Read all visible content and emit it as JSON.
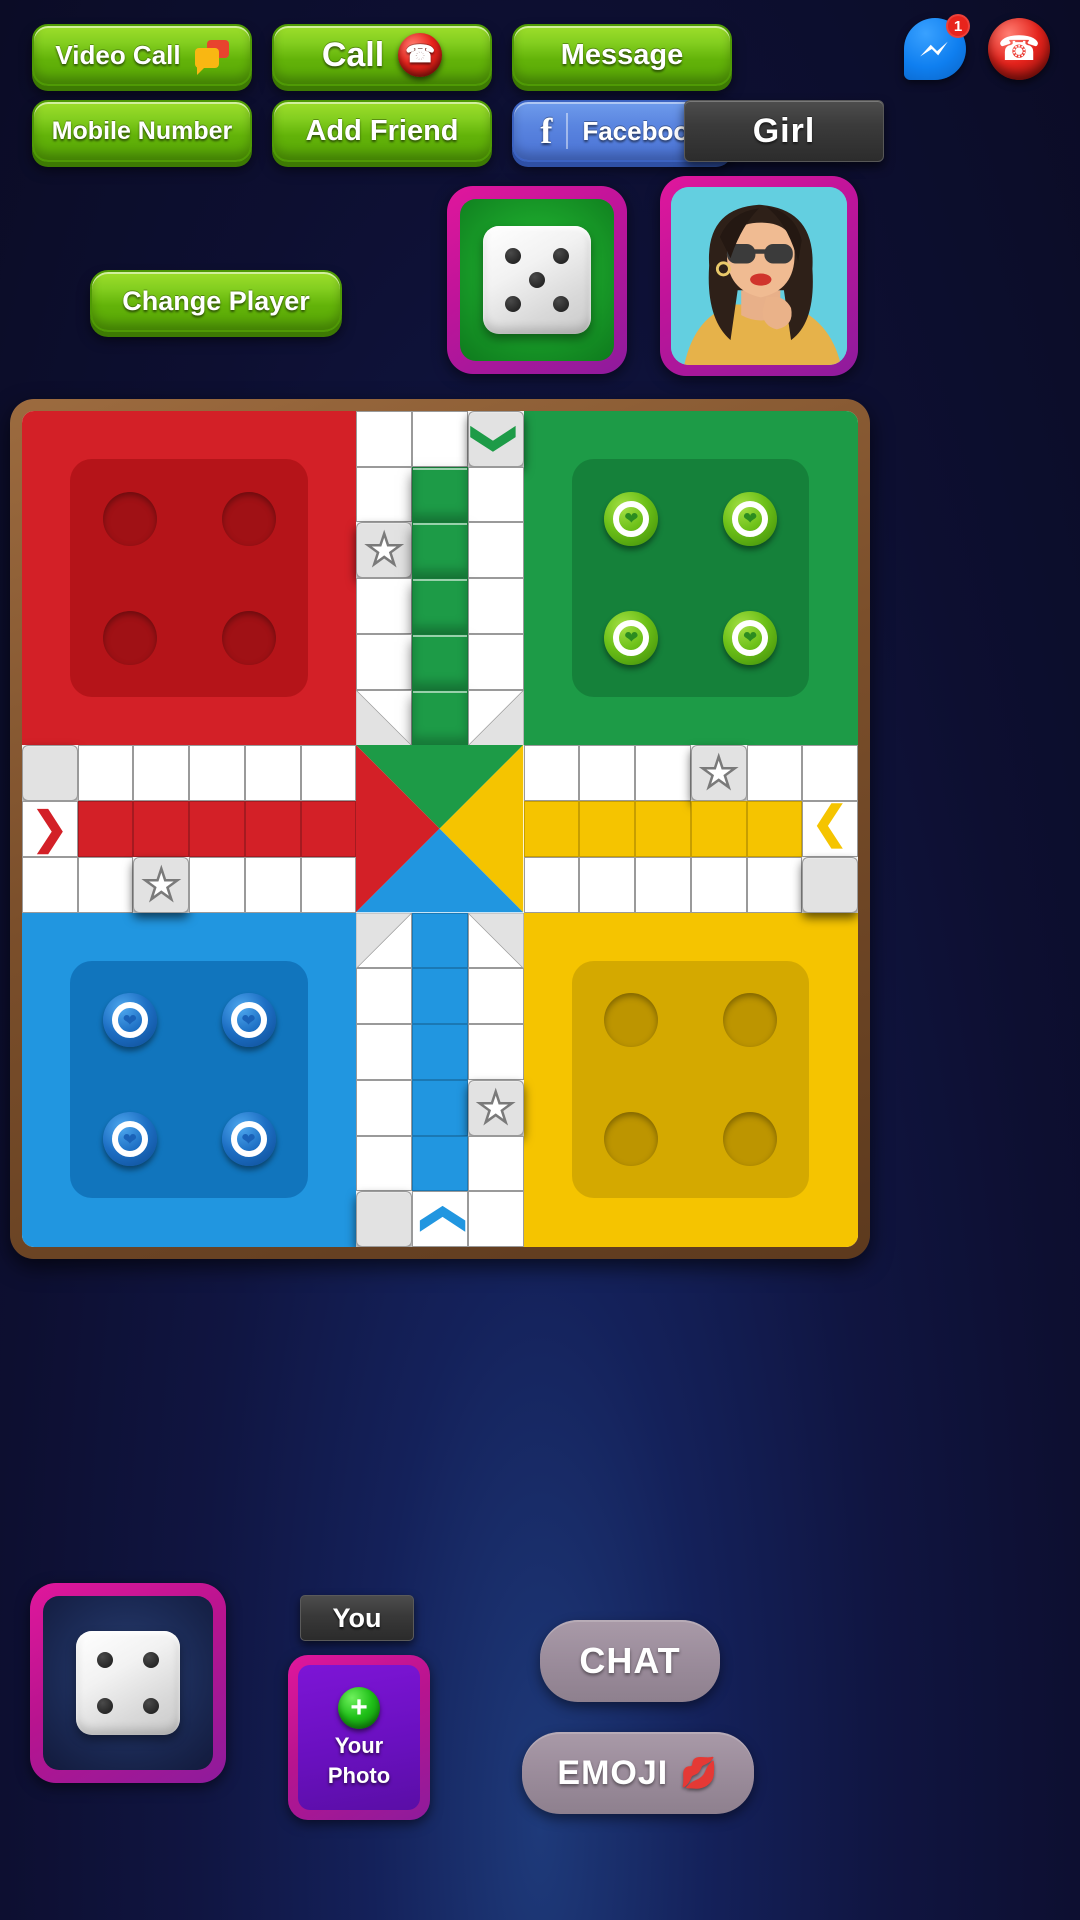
{
  "top_buttons": [
    {
      "id": "video-call",
      "label": "Video Call",
      "icon": "chat-bubble-icon",
      "style": "green"
    },
    {
      "id": "call",
      "label": "Call",
      "icon": "phone-icon",
      "style": "green"
    },
    {
      "id": "message",
      "label": "Message",
      "icon": "none",
      "style": "green"
    },
    {
      "id": "mobile-number",
      "label": "Mobile Number",
      "icon": "none",
      "style": "green"
    },
    {
      "id": "add-friend",
      "label": "Add Friend",
      "icon": "none",
      "style": "green"
    },
    {
      "id": "facebook",
      "label": "Facebook",
      "icon": "facebook-f-icon",
      "style": "blue"
    },
    {
      "id": "girl",
      "label": "Girl",
      "icon": "none",
      "style": "grey"
    }
  ],
  "top_icons": {
    "messenger": {
      "name": "messenger-icon",
      "badge_count": "1"
    },
    "call": {
      "name": "phone-icon"
    }
  },
  "player_row": {
    "change_player_label": "Change Player",
    "active_dice": {
      "owner": "green",
      "value": 5
    },
    "avatar": {
      "name": "opponent-avatar",
      "alt": "Girl player photo"
    }
  },
  "board": {
    "grid": 15,
    "homes": [
      {
        "color": "red",
        "hex": "#d32027",
        "tokens_at_home": 0,
        "slots": 4
      },
      {
        "color": "green",
        "hex": "#1d9b47",
        "tokens_at_home": 4,
        "slots": 4
      },
      {
        "color": "blue",
        "hex": "#2196e0",
        "tokens_at_home": 4,
        "slots": 4
      },
      {
        "color": "yellow",
        "hex": "#f5c400",
        "tokens_at_home": 0,
        "slots": 4
      }
    ],
    "entry_arrows": [
      {
        "color": "green",
        "direction": "down",
        "glyph": "❯"
      },
      {
        "color": "red",
        "direction": "right",
        "glyph": "❯"
      },
      {
        "color": "yellow",
        "direction": "left",
        "glyph": "❮"
      },
      {
        "color": "blue",
        "direction": "up",
        "glyph": "❯"
      }
    ],
    "safe_stars": 4,
    "star_glyph": "★",
    "center_colors": {
      "top": "#1d9b47",
      "left": "#d32027",
      "right": "#f5c400",
      "bottom": "#2196e0"
    }
  },
  "bottom_bar": {
    "my_dice": {
      "owner": "blue",
      "value": 4
    },
    "you_label": "You",
    "your_photo": {
      "plus_glyph": "+",
      "line1": "Your",
      "line2": "Photo"
    },
    "chat_label": "CHAT",
    "emoji_label": "EMOJI",
    "emoji_glyph": "💋"
  },
  "colors": {
    "brand_pink": "#e0179c",
    "green_button": "#84cf20",
    "facebook_blue": "#4a72d4",
    "red": "#d32027",
    "green": "#1d9b47",
    "blue": "#2196e0",
    "yellow": "#f5c400",
    "background": "#101541"
  }
}
